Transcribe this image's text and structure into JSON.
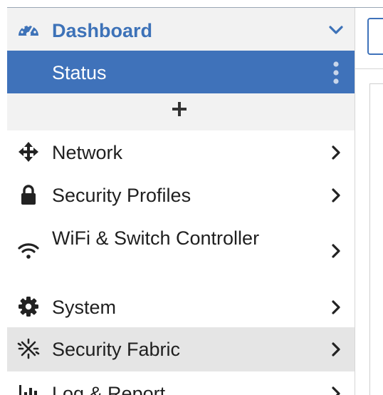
{
  "sidebar": {
    "dashboard": {
      "label": "Dashboard",
      "icon": "gauge-icon",
      "chevron": "chevron-down-icon"
    },
    "status": {
      "label": "Status",
      "menu_icon": "vertical-dots-icon"
    },
    "add_widget": {
      "icon": "plus-icon"
    },
    "items": [
      {
        "label": "Network",
        "icon": "arrows-move-icon"
      },
      {
        "label": "Security Profiles",
        "icon": "lock-icon"
      },
      {
        "label": "WiFi & Switch Controller",
        "icon": "wifi-icon"
      },
      {
        "label": "System",
        "icon": "gear-icon"
      },
      {
        "label": "Security Fabric",
        "icon": "fabric-icon"
      },
      {
        "label": "Log & Report",
        "icon": "bar-chart-icon"
      }
    ]
  },
  "colors": {
    "accent": "#3f72ba",
    "dashboard_text": "#3d72b8",
    "header_bg": "#f2f2f2",
    "highlight_bg": "#e5e5e5",
    "text": "#1f1f1f"
  }
}
